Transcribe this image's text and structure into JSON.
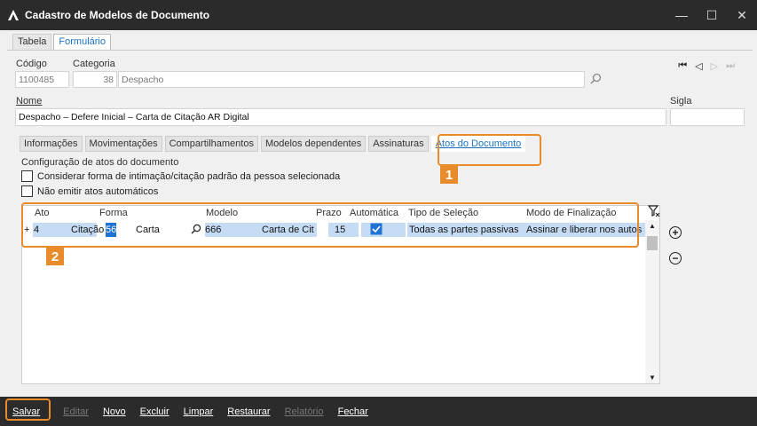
{
  "window": {
    "title": "Cadastro de Modelos de Documento",
    "minimize": "—",
    "maximize": "☐",
    "close": "✕"
  },
  "main_tabs": [
    {
      "label": "Tabela",
      "active": false
    },
    {
      "label": "Formulário",
      "active": true
    }
  ],
  "form": {
    "codigo_label": "Código",
    "codigo_value": "1100485",
    "categoria_label": "Categoria",
    "categoria_code": "38",
    "categoria_value": "Despacho",
    "nome_label": "Nome",
    "nome_value": "Despacho – Defere Inicial – Carta de Citação AR Digital",
    "sigla_label": "Sigla",
    "sigla_value": ""
  },
  "record_nav": {
    "first": "⏮",
    "prev": "◁",
    "next": "▷",
    "last": "⏭"
  },
  "inner_tabs": [
    {
      "label": "Informações",
      "active": false
    },
    {
      "label": "Movimentações",
      "active": false
    },
    {
      "label": "Compartilhamentos",
      "active": false
    },
    {
      "label": "Modelos dependentes",
      "active": false
    },
    {
      "label": "Assinaturas",
      "active": false
    },
    {
      "label": "Atos do Documento",
      "active": true
    }
  ],
  "atos": {
    "section_label": "Configuração de atos do documento",
    "check1_label": "Considerar forma de intimação/citação padrão da pessoa selecionada",
    "check2_label": "Não emitir atos automáticos",
    "columns": [
      "Ato",
      "Forma",
      "Modelo",
      "Prazo",
      "Automática",
      "Tipo de Seleção",
      "Modo de Finalização"
    ],
    "row": {
      "expand": "+",
      "ato_code": "4",
      "ato_name": "Citação",
      "forma_code": "56",
      "forma_name": "Carta",
      "modelo_code": "666",
      "modelo_name": "Carta de Cit",
      "prazo": "15",
      "automatica": true,
      "tipo_selecao": "Todas as partes passivas",
      "modo_finalizacao": "Assinar e liberar nos autos"
    }
  },
  "callouts": {
    "one": "1",
    "two": "2"
  },
  "side_actions": {
    "add": "+",
    "remove": "−"
  },
  "footer": {
    "buttons": [
      {
        "label": "Salvar",
        "enabled": true
      },
      {
        "label": "Editar",
        "enabled": false
      },
      {
        "label": "Novo",
        "enabled": true
      },
      {
        "label": "Excluir",
        "enabled": true
      },
      {
        "label": "Limpar",
        "enabled": true
      },
      {
        "label": "Restaurar",
        "enabled": true
      },
      {
        "label": "Relatório",
        "enabled": false
      },
      {
        "label": "Fechar",
        "enabled": true
      }
    ]
  },
  "colors": {
    "accent": "#e88b2a",
    "link_blue": "#1a73c8",
    "titlebar": "#2b2b2b",
    "selection": "#c6dcf5"
  }
}
